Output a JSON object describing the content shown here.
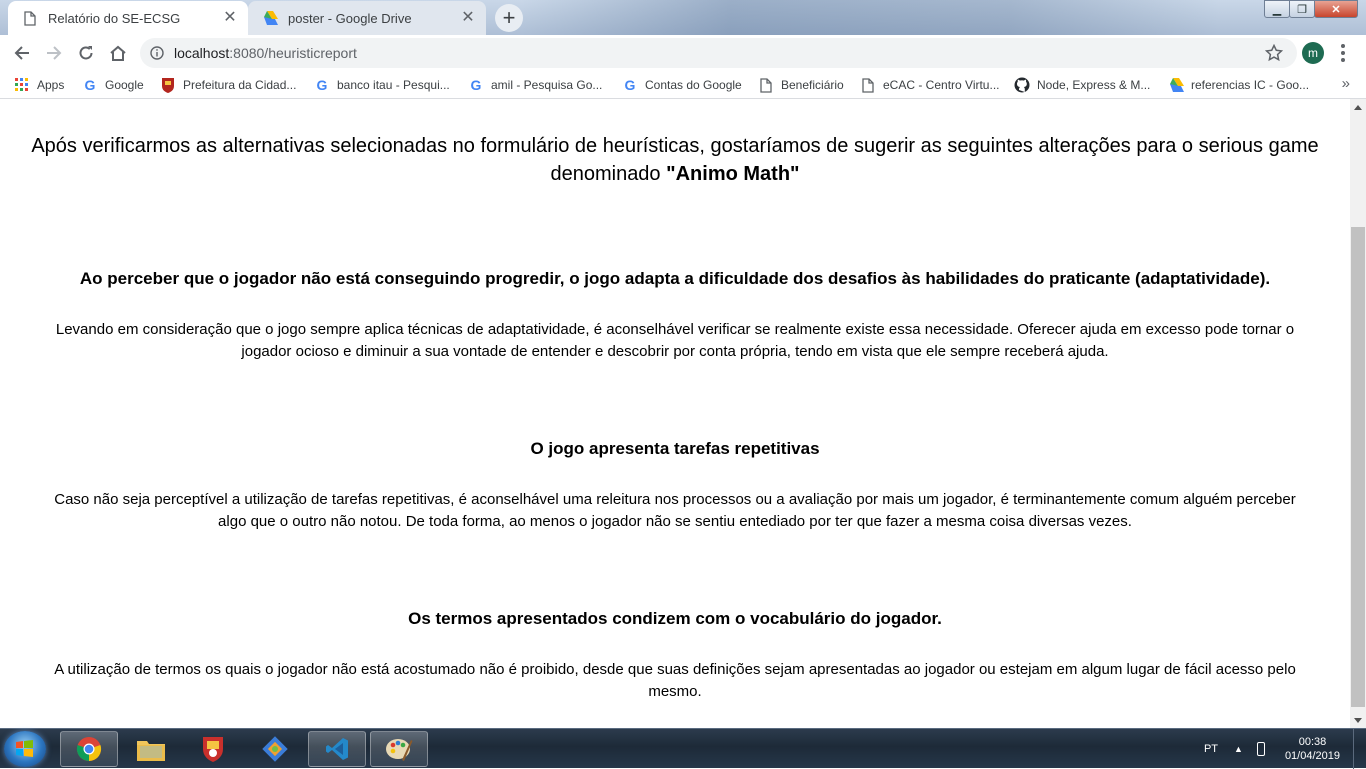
{
  "tabs": [
    {
      "title": "Relatório do SE-ECSG",
      "active": true,
      "icon": "document-icon"
    },
    {
      "title": "poster - Google Drive",
      "active": false,
      "icon": "google-drive-icon"
    }
  ],
  "window": {
    "minimize": "▁",
    "maximize": "❐",
    "close": "✕"
  },
  "toolbar": {
    "url_host": "localhost",
    "url_path": ":8080/heuristicreport",
    "profile_initial": "m"
  },
  "bookmarks": [
    {
      "label": "Apps",
      "icon": "apps-grid-icon"
    },
    {
      "label": "Google",
      "icon": "google-icon"
    },
    {
      "label": "Prefeitura da Cidad...",
      "icon": "prefeitura-crest-icon"
    },
    {
      "label": "banco itau - Pesqui...",
      "icon": "google-icon"
    },
    {
      "label": "amil - Pesquisa Go...",
      "icon": "google-icon"
    },
    {
      "label": "Contas do Google",
      "icon": "google-icon"
    },
    {
      "label": "Beneficiário",
      "icon": "page-icon"
    },
    {
      "label": "eCAC - Centro Virtu...",
      "icon": "page-icon"
    },
    {
      "label": "Node, Express & M...",
      "icon": "github-icon"
    },
    {
      "label": "referencias IC - Goo...",
      "icon": "google-drive-icon"
    }
  ],
  "bookmarks_more": "»",
  "report": {
    "intro": "Após verificarmos as alternativas selecionadas no formulário de heurísticas, gostaríamos de sugerir as seguintes alterações para o serious game denominado",
    "game_name": "\"Animo Math\"",
    "sections": [
      {
        "title": "Ao perceber que o jogador não está conseguindo progredir, o jogo adapta a dificuldade dos desafios às habilidades do praticante (adaptatividade).",
        "body": "Levando em consideração que o jogo sempre aplica técnicas de adaptatividade, é aconselhável verificar se realmente existe essa necessidade. Oferecer ajuda em excesso pode tornar o jogador ocioso e diminuir a sua vontade de entender e descobrir por conta própria, tendo em vista que ele sempre receberá ajuda."
      },
      {
        "title": "O jogo apresenta tarefas repetitivas",
        "body": "Caso não seja perceptível a utilização de tarefas repetitivas, é aconselhável uma releitura nos processos ou a avaliação por mais um jogador, é terminantemente comum alguém perceber algo que o outro não notou. De toda forma, ao menos o jogador não se sentiu entediado por ter que fazer a mesma coisa diversas vezes."
      },
      {
        "title": "Os termos apresentados condizem com o vocabulário do jogador.",
        "body": "A utilização de termos os quais o jogador não está acostumado não é proibido, desde que suas definições sejam apresentadas ao jogador ou estejam em algum lugar de fácil acesso pelo mesmo."
      }
    ]
  },
  "taskbar": {
    "apps": [
      "chrome-icon",
      "file-explorer-icon",
      "game-crest-icon",
      "git-icon",
      "vscode-icon",
      "paint-icon"
    ],
    "language": "PT",
    "time": "00:38",
    "date": "01/04/2019"
  },
  "colors": {
    "accent": "#1a73e8",
    "avatar": "#1e6b52",
    "taskbar": "#1d2a38"
  }
}
